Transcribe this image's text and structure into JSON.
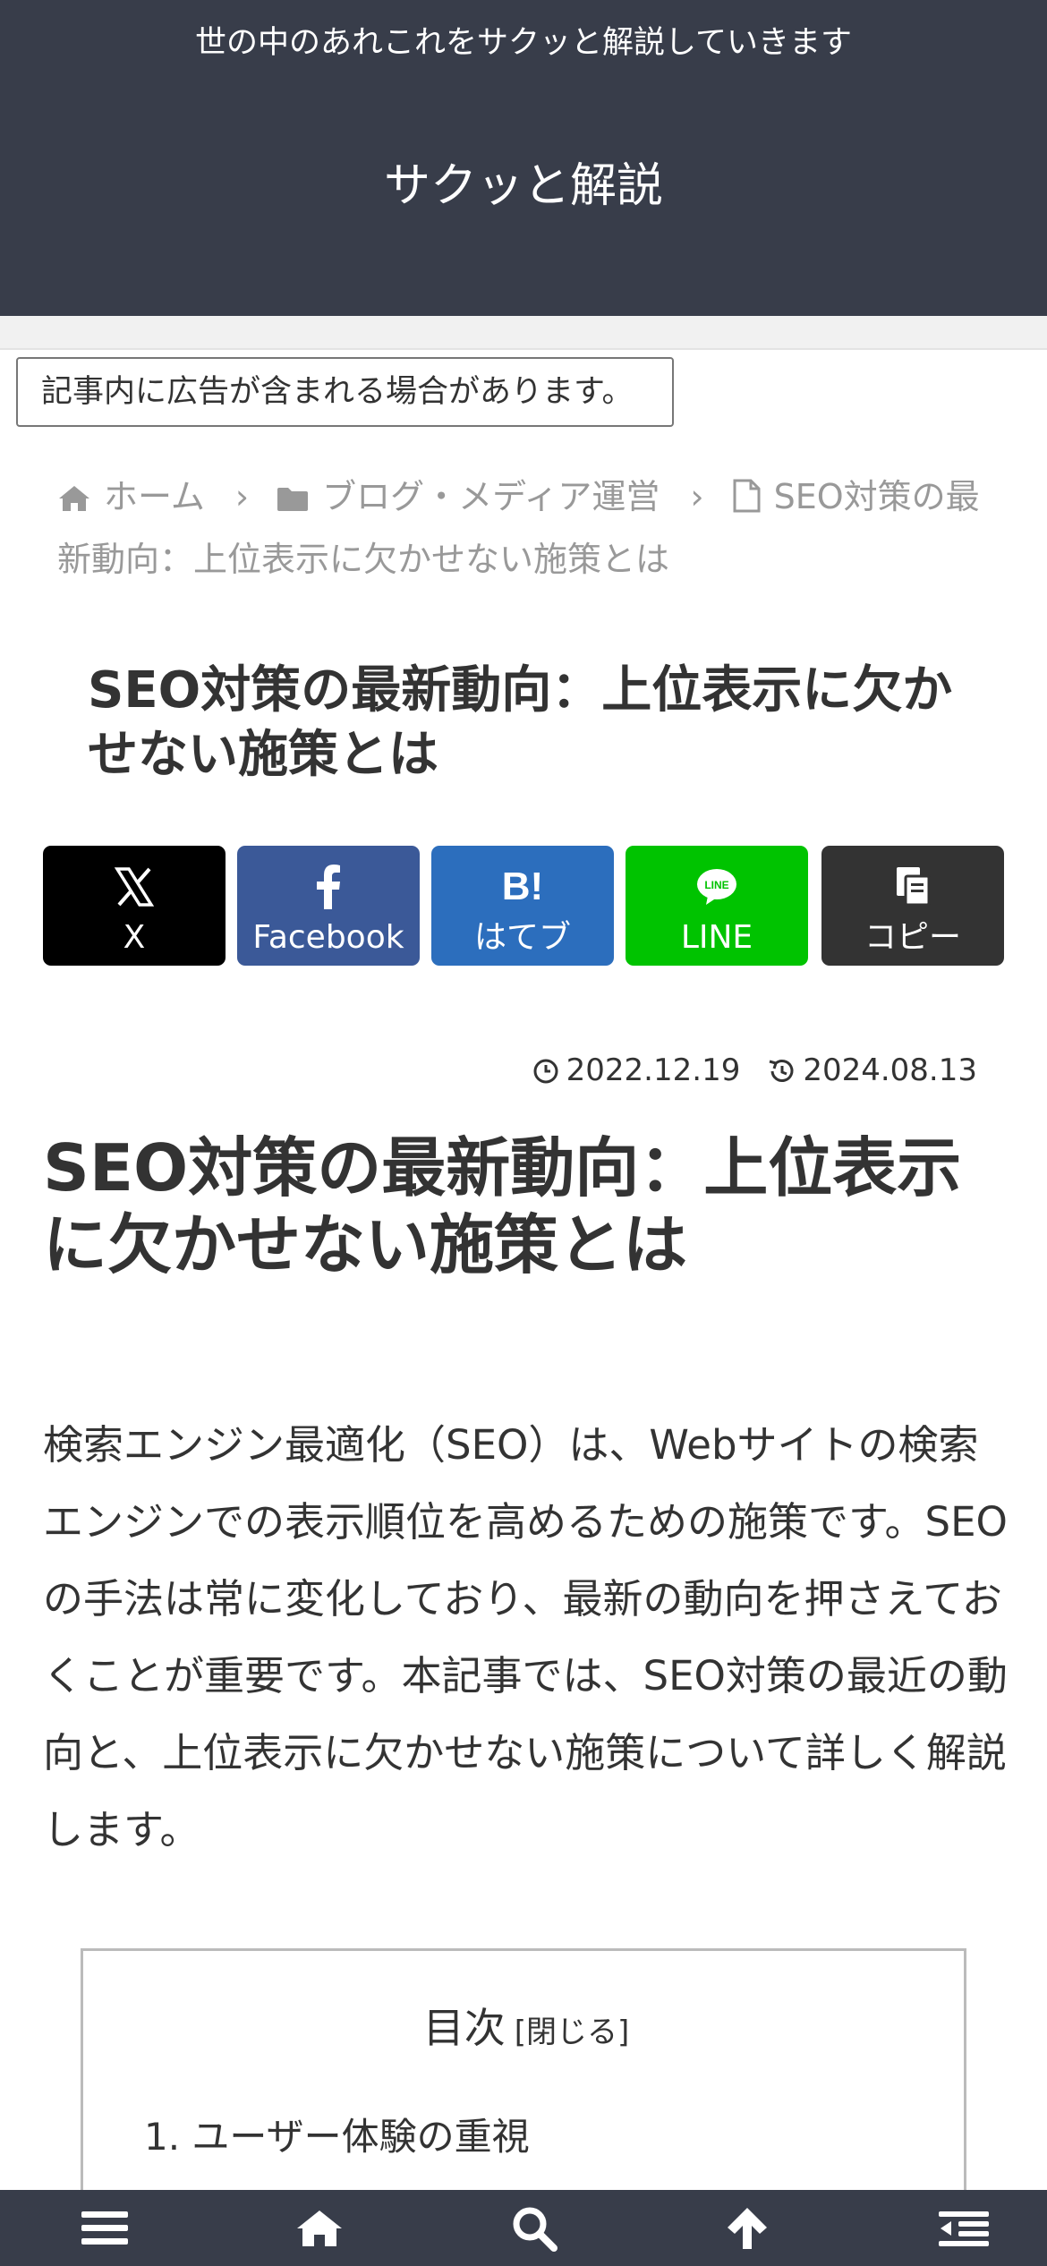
{
  "header": {
    "tagline": "世の中のあれこれをサクッと解説していきます",
    "site_title": "サクッと解説"
  },
  "ad_notice": "記事内に広告が含まれる場合があります。",
  "breadcrumb": {
    "home": "ホーム",
    "category": "ブログ・メディア運営",
    "current": "SEO対策の最新動向：上位表示に欠かせない施策とは"
  },
  "post_title": "SEO対策の最新動向：上位表示に欠かせない施策とは",
  "share": [
    {
      "key": "x",
      "label": "X",
      "icon": "x-logo-icon",
      "color": "#000000"
    },
    {
      "key": "facebook",
      "label": "Facebook",
      "icon": "facebook-icon",
      "color": "#3b5998"
    },
    {
      "key": "hatebu",
      "label": "はてブ",
      "icon": "hatena-bookmark-icon",
      "color": "#2c6ebd"
    },
    {
      "key": "line",
      "label": "LINE",
      "icon": "line-icon",
      "color": "#00c300"
    },
    {
      "key": "copy",
      "label": "コピー",
      "icon": "copy-icon",
      "color": "#333333"
    }
  ],
  "dates": {
    "published": "2022.12.19",
    "updated": "2024.08.13"
  },
  "article": {
    "heading": "SEO対策の最新動向：上位表示に欠かせない施策とは",
    "intro": "検索エンジン最適化（SEO）は、Webサイトの検索エンジンでの表示順位を高めるための施策です。SEOの手法は常に変化しており、最新の動向を押さえておくことが重要です。本記事では、SEO対策の最近の動向と、上位表示に欠かせない施策について詳しく解説します。"
  },
  "toc": {
    "title": "目次",
    "toggle": "[閉じる]",
    "items": [
      "1. ユーザー体験の重視"
    ]
  },
  "footer_nav": {
    "icons": [
      "menu-icon",
      "home-icon",
      "search-icon",
      "arrow-up-icon",
      "sidebar-icon"
    ]
  },
  "colors": {
    "header_bg": "#383d4a",
    "text": "#333333",
    "muted": "#999999"
  }
}
